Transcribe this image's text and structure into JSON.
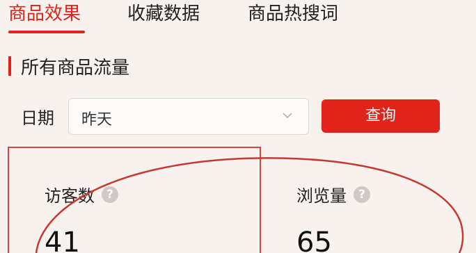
{
  "tabs": [
    {
      "label": "商品效果",
      "active": true
    },
    {
      "label": "收藏数据",
      "active": false
    },
    {
      "label": "商品热搜词",
      "active": false
    }
  ],
  "section": {
    "title": "所有商品流量"
  },
  "filter": {
    "date_label": "日期",
    "date_value": "昨天",
    "query_label": "查询"
  },
  "metrics": [
    {
      "label": "访客数",
      "value": "41"
    },
    {
      "label": "浏览量",
      "value": "65"
    }
  ],
  "icons": {
    "help": "help-circle-icon",
    "chevron": "chevron-down-icon"
  },
  "colors": {
    "accent": "#e2231a",
    "background": "#f7f2ee"
  }
}
